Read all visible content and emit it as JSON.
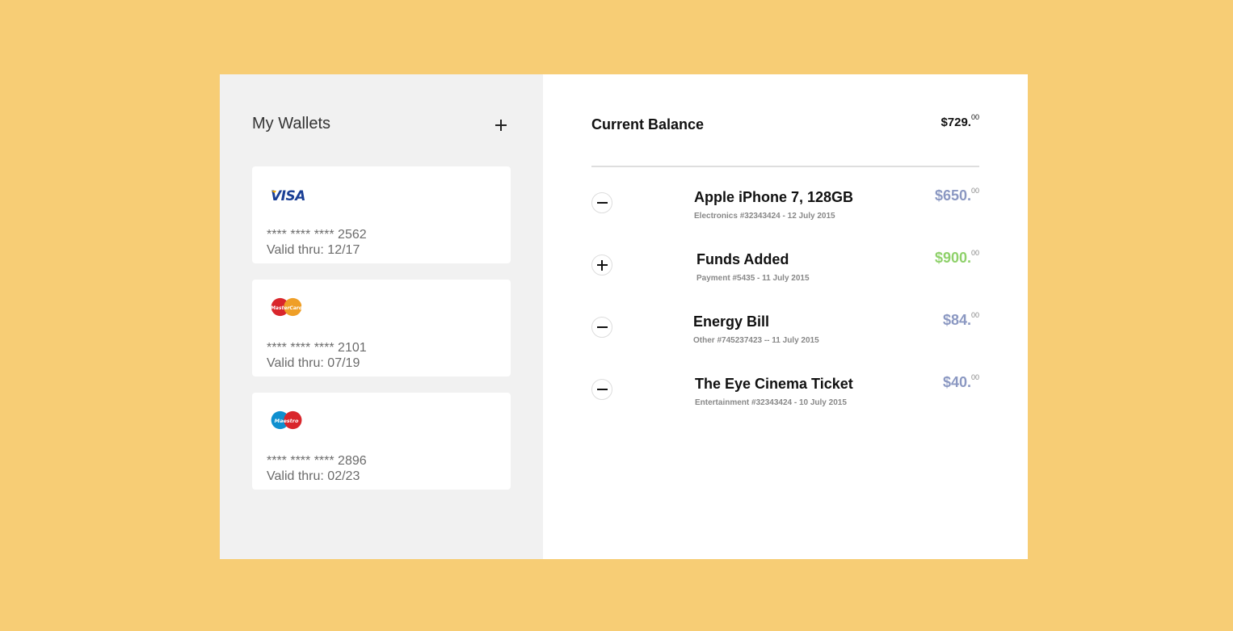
{
  "wallets": {
    "title": "My Wallets",
    "cards": [
      {
        "brand": "VISA",
        "number": "**** **** **** 2562",
        "valid": "Valid thru: 12/17"
      },
      {
        "brand": "MasterCard",
        "number": "**** **** **** 2101",
        "valid": "Valid thru: 07/19"
      },
      {
        "brand": "Maestro",
        "number": "**** **** **** 2896",
        "valid": "Valid thru: 02/23"
      }
    ]
  },
  "balance": {
    "title": "Current Balance",
    "amount": "$729.",
    "cents": "00"
  },
  "transactions": [
    {
      "name": "Apple iPhone 7, 128GB",
      "meta": "Electronics #32343424 - 12 July 2015",
      "amount": "$650.",
      "cents": "00",
      "type": "debit"
    },
    {
      "name": "Funds Added",
      "meta": "Payment #5435 - 11 July 2015",
      "amount": "$900.",
      "cents": "00",
      "type": "credit"
    },
    {
      "name": "Energy Bill",
      "meta": "Other #745237423 -- 11 July 2015",
      "amount": "$84.",
      "cents": "00",
      "type": "debit"
    },
    {
      "name": "The Eye Cinema Ticket",
      "meta": "Entertainment #32343424 - 10 July 2015",
      "amount": "$40.",
      "cents": "00",
      "type": "debit"
    }
  ],
  "colors": {
    "background": "#f7cd75",
    "debit": "#8b98c2",
    "credit": "#8fd16b"
  }
}
